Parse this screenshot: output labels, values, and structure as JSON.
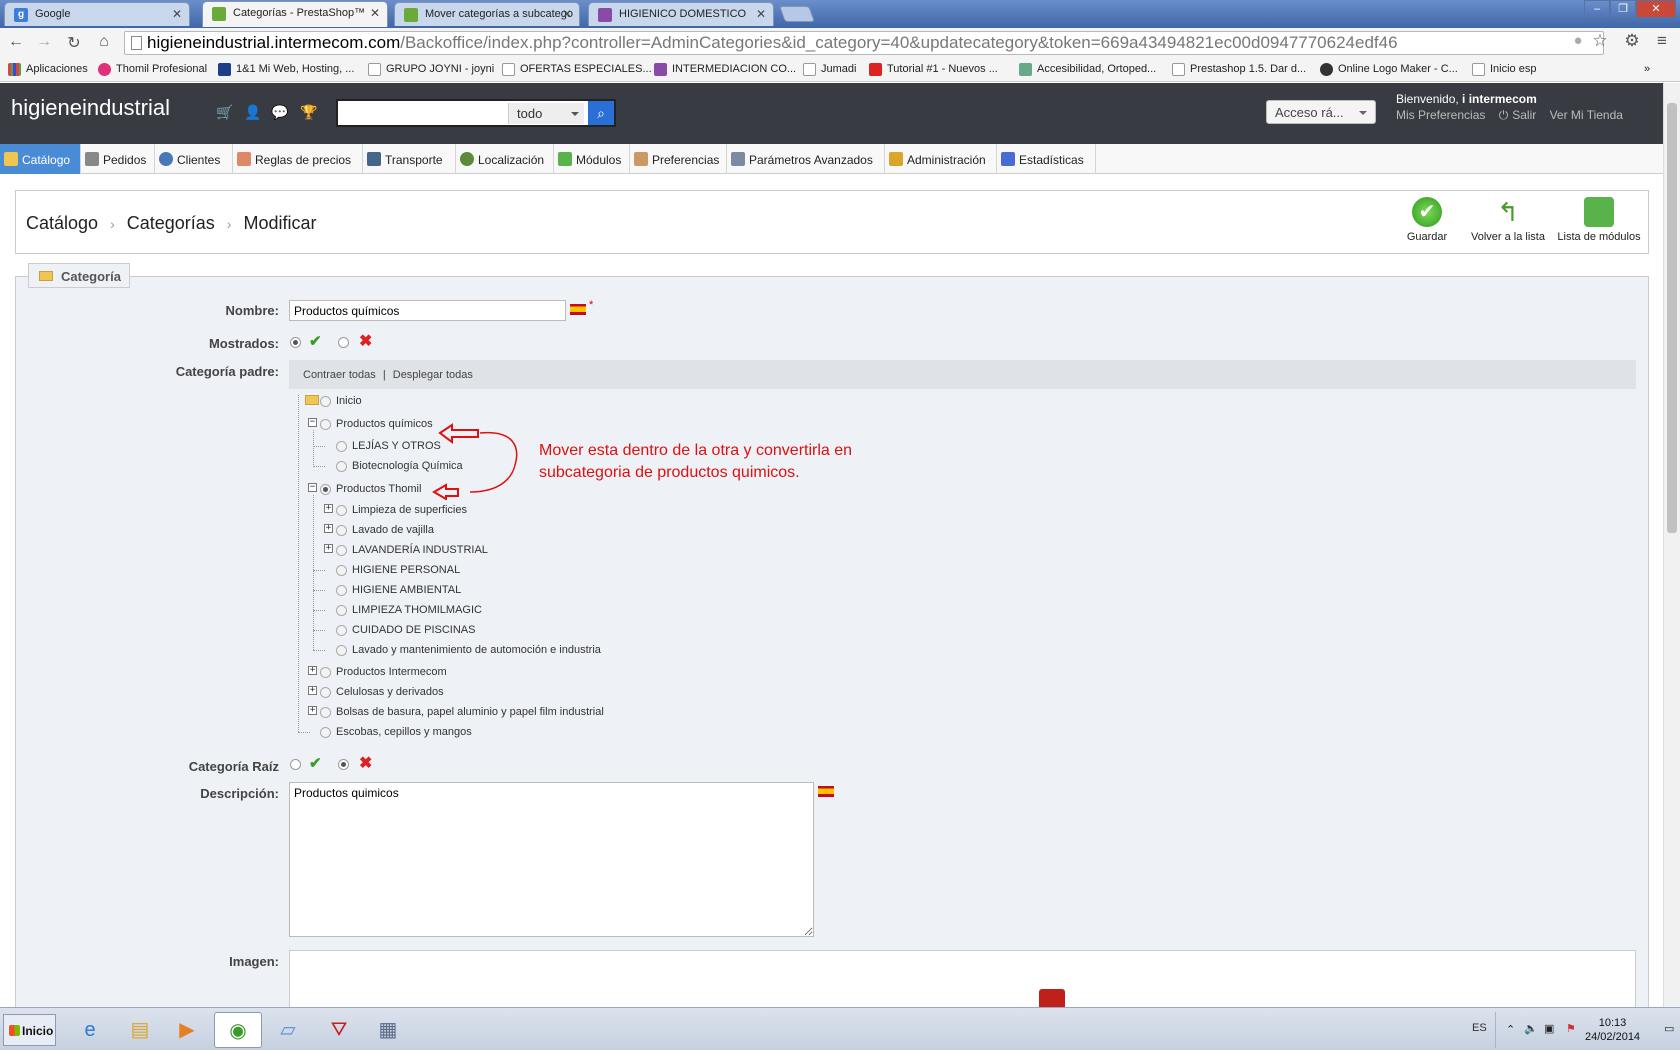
{
  "browser": {
    "tabs": [
      {
        "title": "Google",
        "fav_color": "#3b7ddd",
        "fav_glyph": "g"
      },
      {
        "title": "Categorías - PrestaShop™",
        "fav_color": "#6aaa3a",
        "fav_glyph": ""
      },
      {
        "title": "Mover categorías a subcatego",
        "fav_color": "#6aaa3a",
        "fav_glyph": ""
      },
      {
        "title": "HIGIENICO DOMESTICO",
        "fav_color": "#8a4aa8",
        "fav_glyph": ""
      }
    ],
    "url_host": "higieneindustrial.intermecom.com",
    "url_path": "/Backoffice/index.php?controller=AdminCategories&id_category=40&updatecategory&token=669a43494821ec00d0947770624edf46",
    "bookmarks": [
      {
        "label": "Aplicaciones",
        "color": "#d84"
      },
      {
        "label": "Thomil Profesional",
        "color": "#e0307a"
      },
      {
        "label": "1&1 Mi Web, Hosting, ...",
        "color": "#1c3f8a"
      },
      {
        "label": "GRUPO JOYNI - joyni",
        "color": "#fff"
      },
      {
        "label": "OFERTAS ESPECIALES...",
        "color": "#fff"
      },
      {
        "label": "INTERMEDIACION CO...",
        "color": "#8a4aa8"
      },
      {
        "label": "Jumadi",
        "color": "#fff"
      },
      {
        "label": "Tutorial #1 - Nuevos ...",
        "color": "#d22"
      },
      {
        "label": "Accesibilidad, Ortoped...",
        "color": "#6a8"
      },
      {
        "label": "Prestashop 1.5. Dar d...",
        "color": "#fff"
      },
      {
        "label": "Online Logo Maker - C...",
        "color": "#333"
      },
      {
        "label": "Inicio esp",
        "color": "#fff"
      }
    ],
    "bookmarks_more": "»"
  },
  "admin": {
    "shop_name": "higieneindustrial",
    "search_placeholder": "",
    "search_scope": "todo",
    "quick_access": "Acceso rá...",
    "welcome_prefix": "Bienvenido, ",
    "welcome_user": "i intermecom",
    "links": [
      "Mis Preferencias",
      "Salir",
      "Ver Mi Tienda"
    ]
  },
  "menu": [
    {
      "label": "Catálogo",
      "color": "#f1c551",
      "active": true
    },
    {
      "label": "Pedidos",
      "color": "#888"
    },
    {
      "label": "Clientes",
      "color": "#4a77b8"
    },
    {
      "label": "Reglas de precios",
      "color": "#d86"
    },
    {
      "label": "Transporte",
      "color": "#468"
    },
    {
      "label": "Localización",
      "color": "#5a8a3a"
    },
    {
      "label": "Módulos",
      "color": "#5ab34a"
    },
    {
      "label": "Preferencias",
      "color": "#c96"
    },
    {
      "label": "Parámetros Avanzados",
      "color": "#7a8aa0"
    },
    {
      "label": "Administración",
      "color": "#d9a62a"
    },
    {
      "label": "Estadísticas",
      "color": "#4a6ad6"
    }
  ],
  "breadcrumb": [
    "Catálogo",
    "Categorías",
    "Modificar"
  ],
  "toolbar": {
    "save": "Guardar",
    "back": "Volver a la lista",
    "modules": "Lista de módulos"
  },
  "form": {
    "legend": "Categoría",
    "name_label": "Nombre:",
    "name_value": "Productos químicos",
    "required_mark": "*",
    "displayed_label": "Mostrados:",
    "parent_label": "Categoría padre:",
    "tree_collapse": "Contraer todas",
    "tree_divider": "|",
    "tree_expand": "Desplegar todas",
    "tree": [
      {
        "label": "Inicio"
      },
      {
        "label": "Productos químicos"
      },
      {
        "label": "LEJÍAS Y OTROS"
      },
      {
        "label": "Biotecnología Química"
      },
      {
        "label": "Productos Thomil"
      },
      {
        "label": "Limpieza de superficies"
      },
      {
        "label": "Lavado de vajilla"
      },
      {
        "label": "LAVANDERÍA INDUSTRIAL"
      },
      {
        "label": "HIGIENE PERSONAL"
      },
      {
        "label": "HIGIENE AMBIENTAL"
      },
      {
        "label": "LIMPIEZA THOMILMAGIC"
      },
      {
        "label": "CUIDADO DE PISCINAS"
      },
      {
        "label": "Lavado y mantenimiento de automoción e industria"
      },
      {
        "label": "Productos Intermecom"
      },
      {
        "label": "Celulosas y derivados"
      },
      {
        "label": "Bolsas de basura, papel aluminio y papel film industrial"
      },
      {
        "label": "Escobas, cepillos y mangos"
      }
    ],
    "annotation": "Mover esta dentro de la otra y convertirla en subcategoria de productos quimicos.",
    "root_label": "Categoría Raíz",
    "desc_label": "Descripción:",
    "desc_value": "Productos quimicos",
    "image_label": "Imagen:"
  },
  "taskbar": {
    "start": "Inicio",
    "lang": "ES",
    "time": "10:13",
    "date": "24/02/2014"
  }
}
